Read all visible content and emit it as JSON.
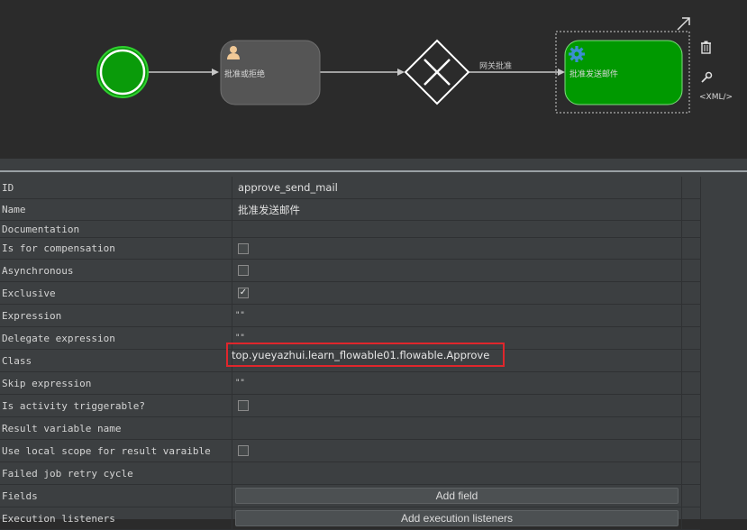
{
  "diagram": {
    "start_event_color": "#0a9b0a",
    "user_task": {
      "label": "批准或拒绝",
      "icon": "user-icon",
      "fill": "#555555"
    },
    "gateway": {
      "icon": "exclusive-gateway-x-icon"
    },
    "flow_label": "网关批准",
    "service_task": {
      "label": "批准发送邮件",
      "icon": "gear-icon",
      "fill": "#009900"
    },
    "tools": {
      "resize_icon": "resize-arrow-icon",
      "delete_icon": "trash-icon",
      "settings_icon": "wrench-icon",
      "xml_label": "<XML/>"
    }
  },
  "properties": {
    "id": {
      "label": "ID",
      "value": "approve_send_mail"
    },
    "name": {
      "label": "Name",
      "value": "批准发送邮件"
    },
    "documentation": {
      "label": "Documentation",
      "value": ""
    },
    "is_for_compensation": {
      "label": "Is for compensation",
      "checked": false
    },
    "asynchronous": {
      "label": "Asynchronous",
      "checked": false
    },
    "exclusive": {
      "label": "Exclusive",
      "checked": true,
      "check_mark": "✓"
    },
    "expression": {
      "label": "Expression",
      "value": "\"\""
    },
    "delegate_expression": {
      "label": "Delegate expression",
      "value": "\"\""
    },
    "class": {
      "label": "Class",
      "value": "top.yueyazhui.learn_flowable01.flowable.Approve",
      "highlight_color": "#e0262c"
    },
    "skip_expression": {
      "label": "Skip expression",
      "value": "\"\""
    },
    "is_activity_triggerable": {
      "label": "Is activity triggerable?",
      "checked": false
    },
    "result_variable_name": {
      "label": "Result variable name",
      "value": ""
    },
    "use_local_scope": {
      "label": "Use local scope for result varaible",
      "checked": false
    },
    "failed_job_retry_cycle": {
      "label": "Failed job retry cycle",
      "value": ""
    },
    "fields": {
      "label": "Fields",
      "button": "Add field"
    },
    "execution_listeners": {
      "label": "Execution listeners",
      "button": "Add execution listeners"
    }
  }
}
